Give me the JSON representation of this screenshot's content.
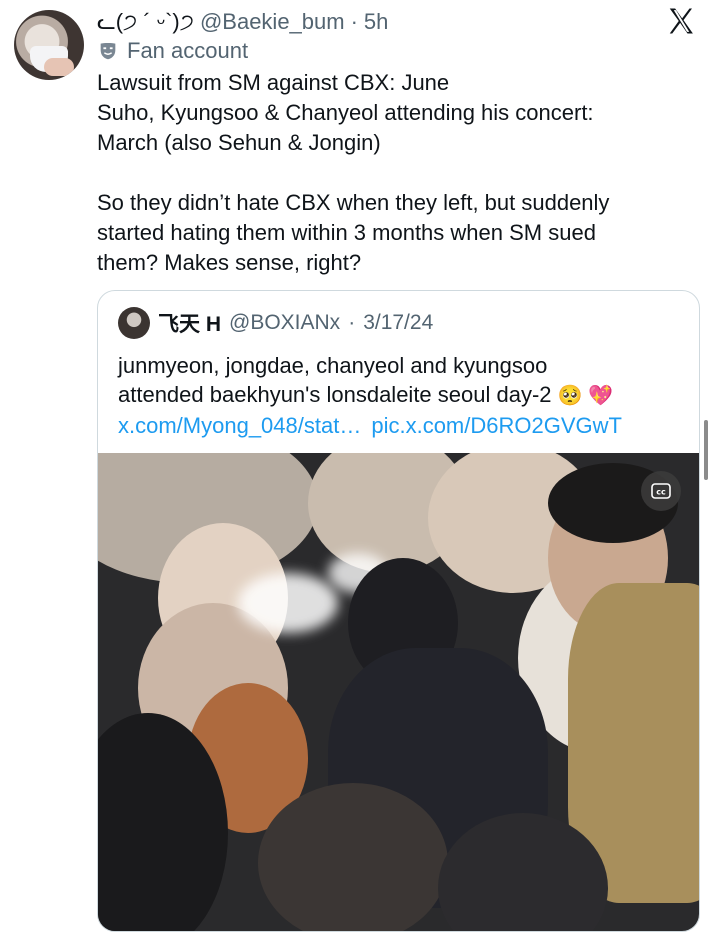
{
  "author": {
    "display_name": "ᓚ(੭ ´ ᵕ`)੭",
    "handle": "@Baekie_bum",
    "separator": "·",
    "time": "5h",
    "badge": "Fan account"
  },
  "tweet": {
    "lines": [
      "Lawsuit from SM against CBX: June",
      "Suho, Kyungsoo & Chanyeol attending his concert:",
      "March (also Sehun & Jongin)",
      "",
      "So they didn’t hate CBX when they left, but suddenly",
      "started hating them within 3 months when SM sued",
      "them? Makes sense, right?"
    ]
  },
  "quote": {
    "name": "飞天 H",
    "handle": "@BOXIANx",
    "separator": "·",
    "date": "3/17/24",
    "line1": "junmyeon, jongdae, chanyeol and kyungsoo",
    "line2": "attended baekhyun's lonsdaleite seoul day-2",
    "emoji": "🥺 💖",
    "link1": "x.com/Myong_048/stat…",
    "link2": "pic.x.com/D6RO2GVGwT"
  },
  "icons": {
    "x_logo": "x-logo-icon",
    "badge": "theater-mask-icon",
    "captions": "closed-captions-icon"
  }
}
